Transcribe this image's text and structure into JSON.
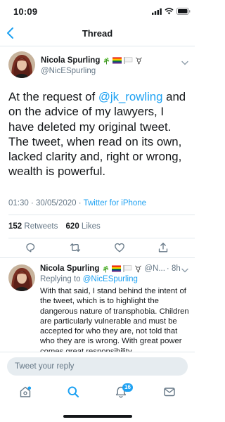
{
  "status_bar": {
    "time": "10:09"
  },
  "nav": {
    "title": "Thread"
  },
  "main_tweet": {
    "display_name": "Nicola Spurling",
    "emojis": [
      "herb-emoji",
      "rainbow-flag-emoji",
      "white-flag-emoji",
      "transgender-symbol-emoji"
    ],
    "handle": "@NicESpurling",
    "text_before_mention": "At the request of ",
    "mention": "@jk_rowling",
    "text_after_mention": " and on the advice of my lawyers, I have deleted my original tweet. The tweet, when read on its own, lacked clarity and, right or wrong, wealth is powerful.",
    "time": "01:30",
    "date": "30/05/2020",
    "separator": " · ",
    "source": "Twitter for iPhone",
    "retweets_count": "152",
    "retweets_label": "Retweets",
    "likes_count": "620",
    "likes_label": "Likes",
    "actions": [
      "reply-icon",
      "retweet-icon",
      "like-icon",
      "share-icon"
    ]
  },
  "reply_tweet": {
    "display_name": "Nicola Spurling",
    "handle_truncated": "@N...",
    "time_ago": "· 8h",
    "replying_to_label": "Replying to ",
    "replying_to_handle": "@NicESpurling",
    "text": "With that said, I stand behind the intent of the tweet, which is to highlight the dangerous nature of transphobia. Children are particularly vulnerable and must be accepted for who they are, not told that who they are is wrong. With great power comes great responsibility."
  },
  "composer": {
    "placeholder": "Tweet your reply"
  },
  "tab_bar": {
    "items": [
      "home-icon",
      "search-icon",
      "notifications-icon",
      "messages-icon"
    ],
    "notifications_badge": "16"
  },
  "colors": {
    "accent": "#1da1f2",
    "text": "#14171a",
    "secondary_text": "#657786",
    "divider": "#e1e8ed"
  }
}
